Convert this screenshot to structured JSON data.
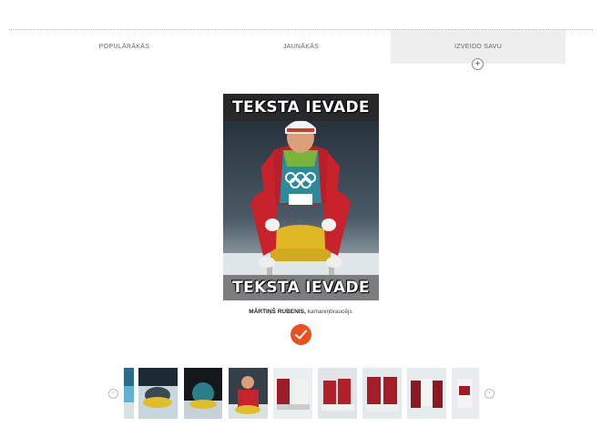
{
  "tabs": [
    {
      "label": "POPULĀRĀKĀS",
      "active": false
    },
    {
      "label": "JAUNĀKĀS",
      "active": false
    },
    {
      "label": "IZVEIDO SAVU",
      "active": true
    }
  ],
  "meme": {
    "top_text": "TEKSTA IEVADE",
    "bottom_text": "TEKSTA IEVADE"
  },
  "person": {
    "name": "MĀRTIŅŠ RUBENIS,",
    "role": "kamaniņbraucējs"
  },
  "colors": {
    "accent": "#ea4f1f",
    "active_tab_bg": "#eeeeee"
  },
  "icons": {
    "add": "plus-circle",
    "confirm": "checkmark",
    "prev": "chevron-left",
    "next": "chevron-right"
  },
  "thumbnails_count": 9
}
